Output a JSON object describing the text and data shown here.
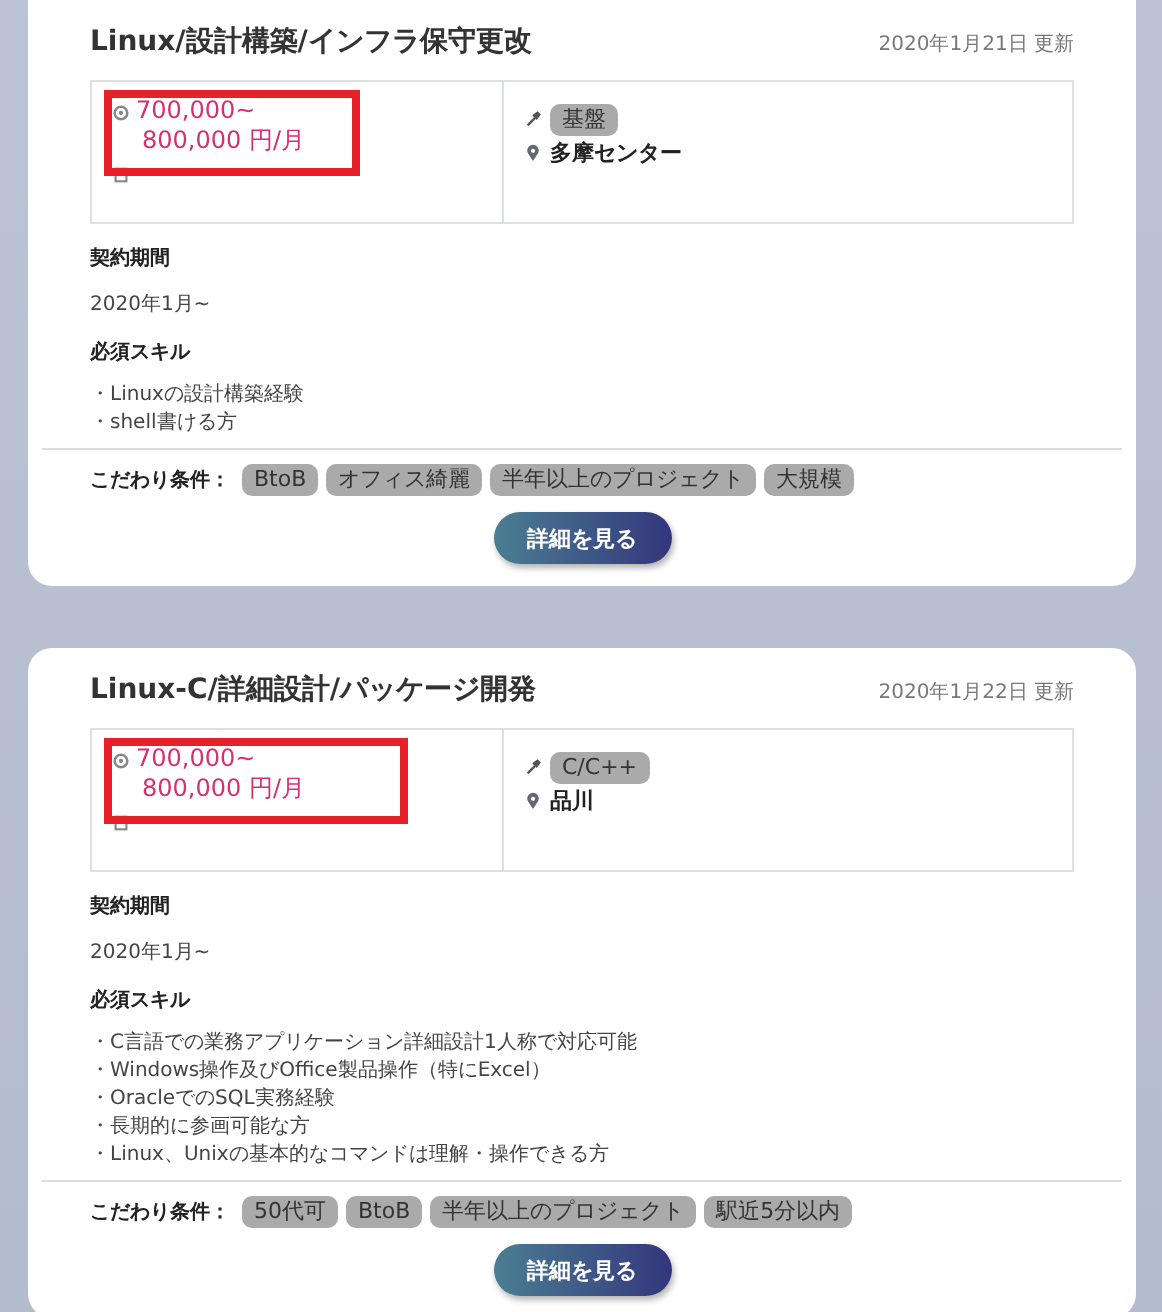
{
  "cards": [
    {
      "title": "Linux/設計構築/インフラ保守更改",
      "updated": "2020年1月21日 更新",
      "salary": {
        "lines": [
          "700,000~",
          "800,000 円/月"
        ],
        "highlighted": true
      },
      "skill_tag": "基盤",
      "location": "多摩センター",
      "period_label": "契約期間",
      "period": "2020年1月~",
      "skills_label": "必須スキル",
      "skills": [
        "・Linuxの設計構築経験",
        "・shell書ける方"
      ],
      "conditions_label": "こだわり条件：",
      "conditions": [
        "BtoB",
        "オフィス綺麗",
        "半年以上のプロジェクト",
        "大規模"
      ],
      "button": "詳細を見る"
    },
    {
      "title": "Linux-C/詳細設計/パッケージ開発",
      "updated": "2020年1月22日 更新",
      "salary": {
        "lines": [
          "700,000~",
          "800,000 円/月"
        ],
        "highlighted": true
      },
      "skill_tag": "C/C++",
      "location": "品川",
      "period_label": "契約期間",
      "period": "2020年1月~",
      "skills_label": "必須スキル",
      "skills": [
        "・C言語での業務アプリケーション詳細設計1人称で対応可能",
        "・Windows操作及びOffice製品操作（特にExcel）",
        "・OracleでのSQL実務経験",
        "・長期的に参画可能な方",
        "・Linux、Unixの基本的なコマンドは理解・操作できる方"
      ],
      "conditions_label": "こだわり条件：",
      "conditions": [
        "50代可",
        "BtoB",
        "半年以上のプロジェクト",
        "駅近5分以内"
      ],
      "button": "詳細を見る"
    }
  ]
}
